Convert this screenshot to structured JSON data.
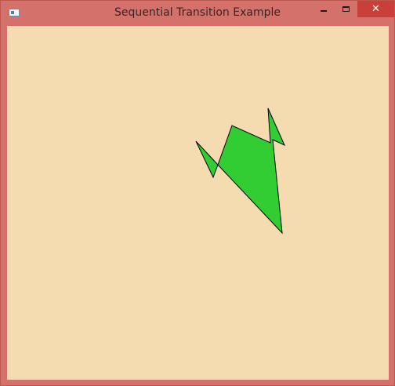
{
  "window": {
    "title": "Sequential Transition Example",
    "close_glyph": "✕",
    "icons": {
      "app": "java-window-icon",
      "minimize": "minimize-icon",
      "maximize": "maximize-icon",
      "close": "close-icon"
    }
  },
  "colors": {
    "frame": "#d4716a",
    "close_button": "#c9403a",
    "content_background": "#f4dcb0",
    "shape_fill": "#32cd32",
    "shape_stroke": "#000000"
  }
}
